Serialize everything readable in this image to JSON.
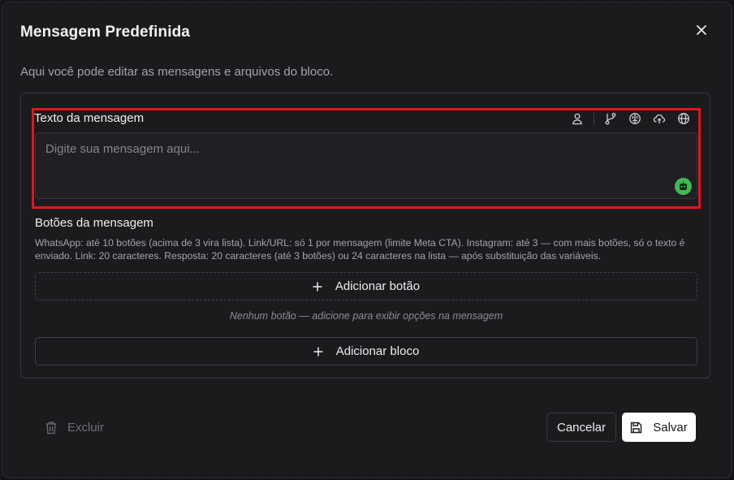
{
  "dialog": {
    "title": "Mensagem Predefinida",
    "subtitle": "Aqui você pode editar as mensagens e arquivos do bloco."
  },
  "message": {
    "label": "Texto da mensagem",
    "placeholder": "Digite sua mensagem aqui...",
    "value": "",
    "toolbar_icons": [
      "user-icon",
      "git-branch-icon",
      "brain-icon",
      "cloud-upload-icon",
      "globe-icon"
    ]
  },
  "buttons_section": {
    "label": "Botões da mensagem",
    "help": "WhatsApp: até 10 botões (acima de 3 vira lista). Link/URL: só 1 por mensagem (limite Meta CTA). Instagram: até 3 — com mais botões, só o texto é enviado. Link: 20 caracteres. Resposta: 20 caracteres (até 3 botões) ou 24 caracteres na lista — após substituição das variáveis.",
    "add_button_label": "Adicionar botão",
    "empty_note": "Nenhum botão — adicione para exibir opções na mensagem",
    "add_block_label": "Adicionar bloco"
  },
  "footer": {
    "delete_label": "Excluir",
    "cancel_label": "Cancelar",
    "save_label": "Salvar"
  },
  "colors": {
    "highlight": "#e3141b",
    "bot_button": "#3dbb52",
    "save_button_bg": "#ffffff"
  }
}
